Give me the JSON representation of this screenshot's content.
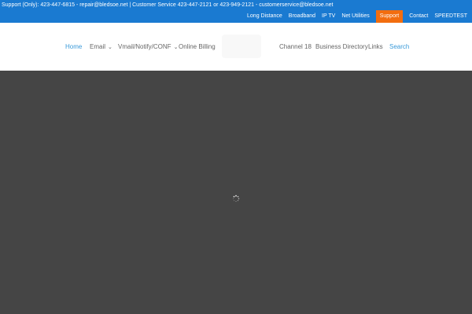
{
  "topbar": {
    "info_text": "Support (Only): 423-447-6815 - repair@bledsoe.net | Customer Service 423-447-2121 or 423-949-2121 - customerservice@bledsoe.net",
    "links": [
      "Long Distance",
      "Broadband",
      "IP TV",
      "Net Utilities",
      "Support",
      "Contact",
      "SPEEDTEST"
    ],
    "accent_color": "#1a7ad1",
    "support_color": "#f26d0f"
  },
  "nav": {
    "items": [
      "Home",
      "Email",
      "Vmail/Notify/CONF",
      "Online Billing",
      "Channel 18",
      "Business Directory",
      "Links",
      "Search"
    ],
    "active_color": "#3a9ad9"
  },
  "main": {
    "background": "#454545",
    "loader_icon": "spinner-icon"
  }
}
